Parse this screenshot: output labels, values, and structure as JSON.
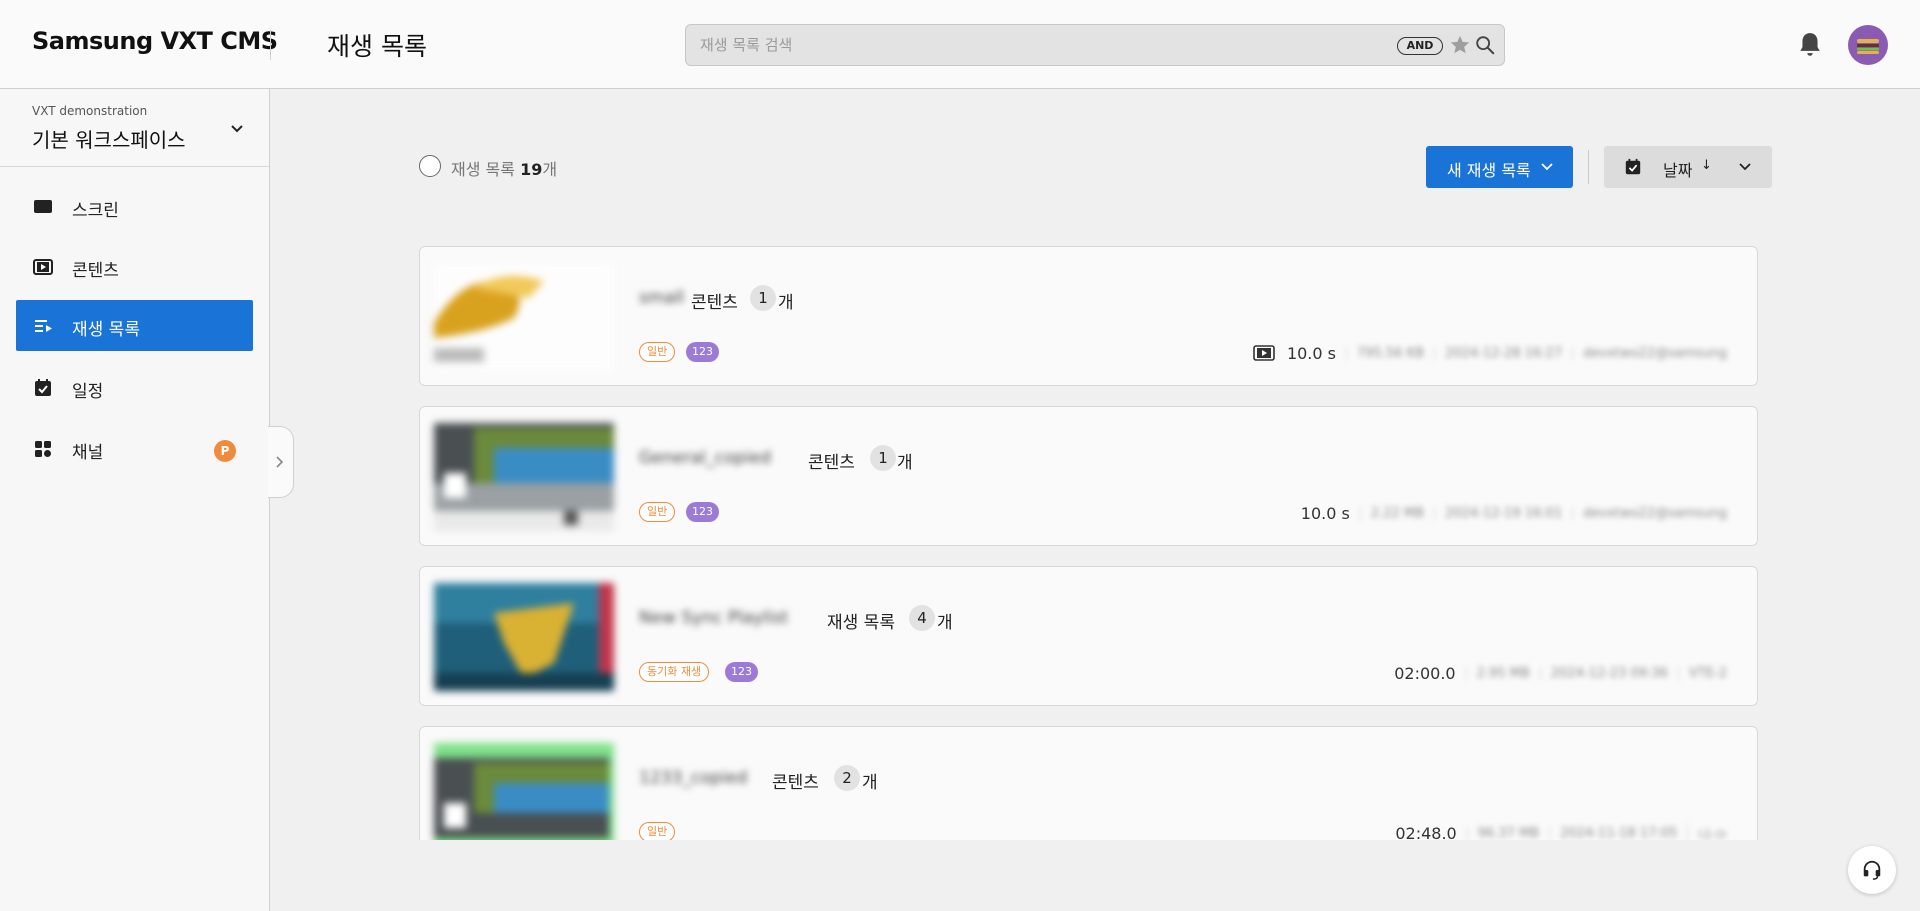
{
  "header": {
    "logo": "Samsung VXT CMS",
    "title": "재생 목록",
    "search_placeholder": "재생 목록 검색",
    "search_operator": "AND"
  },
  "workspace": {
    "org": "VXT demonstration",
    "name": "기본 워크스페이스"
  },
  "sidebar": {
    "items": [
      {
        "label": "스크린",
        "icon": "screen-icon"
      },
      {
        "label": "콘텐츠",
        "icon": "content-icon"
      },
      {
        "label": "재생 목록",
        "icon": "playlist-icon",
        "active": true
      },
      {
        "label": "일정",
        "icon": "schedule-icon"
      },
      {
        "label": "채널",
        "icon": "channel-icon",
        "badge": "P"
      }
    ]
  },
  "toolbar": {
    "count_prefix": "재생 목록 ",
    "count": "19",
    "count_suffix": "개",
    "new_button": "새 재생 목록",
    "sort_label": "날짜",
    "sort_dir": "↓"
  },
  "playlists": [
    {
      "name": "small",
      "type": "콘텐츠",
      "count": "1",
      "unit": "개",
      "tag": "일반",
      "badge": "123",
      "duration": "10.0 s",
      "meta": [
        "795.56 KB",
        "2024-12-28 16:27",
        "devxtwo22@samsung"
      ]
    },
    {
      "name": "General_copied",
      "type": "콘텐츠",
      "count": "1",
      "unit": "개",
      "tag": "일반",
      "badge": "123",
      "duration": "10.0 s",
      "meta": [
        "2.22 MB",
        "2024-12-19 16:01",
        "devxtwo22@samsung"
      ]
    },
    {
      "name": "New Sync Playlist",
      "type": "재생 목록",
      "count": "4",
      "unit": "개",
      "tag": "동기화 재생",
      "badge": "123",
      "duration": "02:00.0",
      "meta": [
        "2.95 MB",
        "2024-12-23 09:36",
        "VTE-2"
      ]
    },
    {
      "name": "1233_copied",
      "type": "콘텐츠",
      "count": "2",
      "unit": "개",
      "tag": "일반",
      "badge": "",
      "duration": "02:48.0",
      "meta": [
        "96.37 MB",
        "2024-11-18 17:05",
        "나-ㅁ"
      ]
    }
  ],
  "colors": {
    "primary": "#1a73d6",
    "tag_orange": "#f08b3e",
    "badge_purple": "#9c7bd8"
  }
}
